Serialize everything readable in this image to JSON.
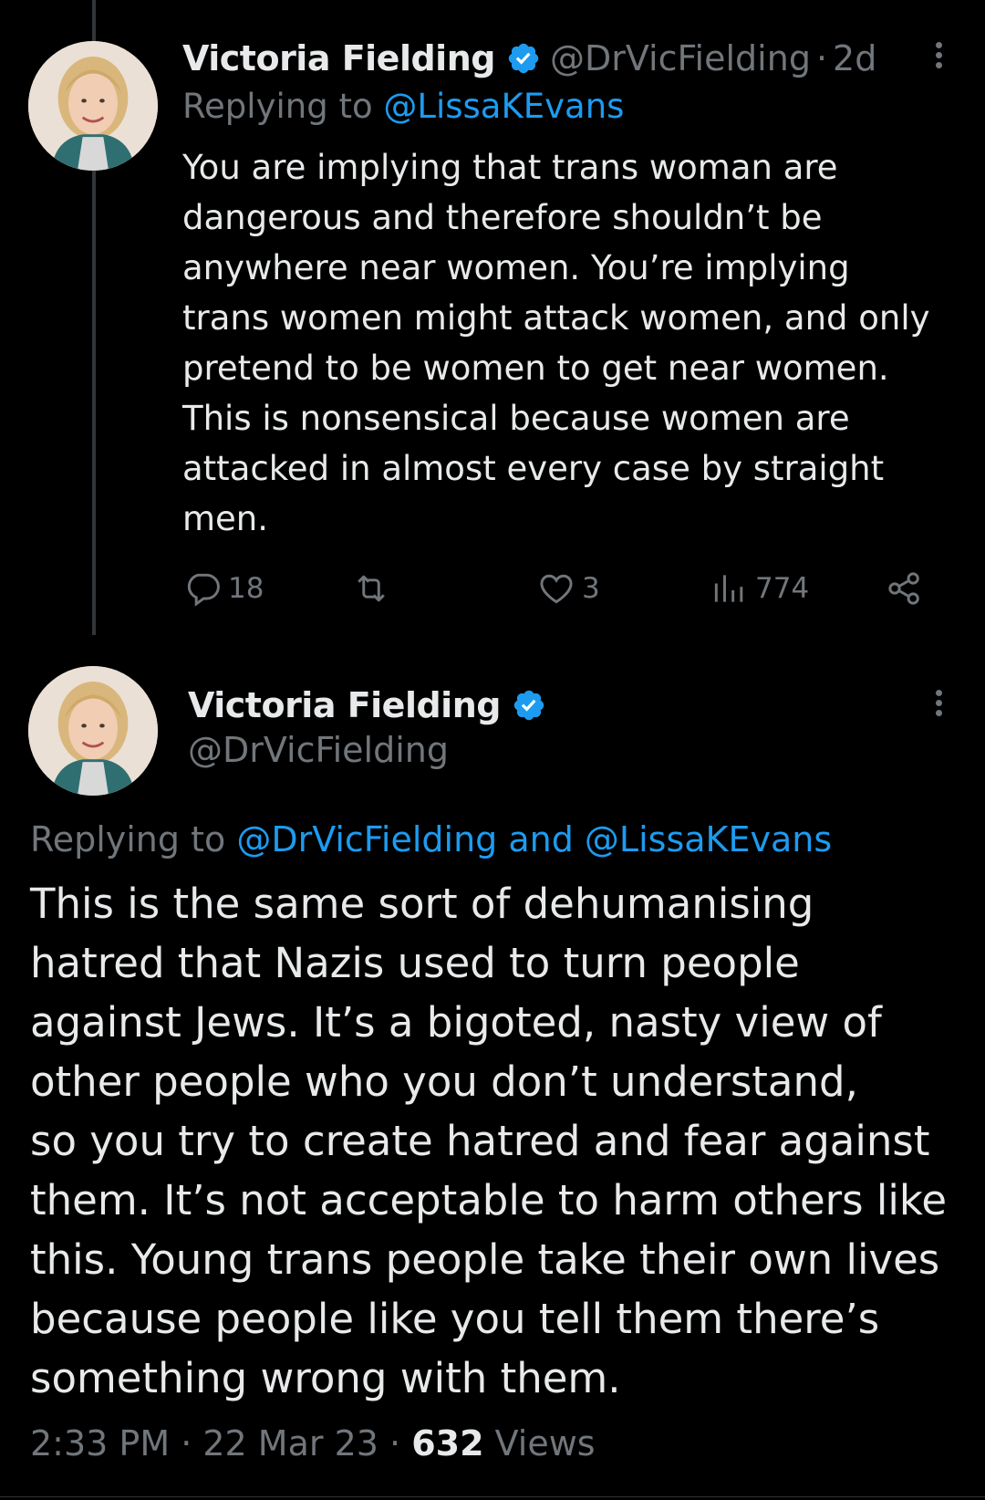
{
  "colors": {
    "background": "#000000",
    "text": "#e7e9ea",
    "muted": "#71767b",
    "link": "#1d9bf0",
    "verified_badge": "#1d9bf0"
  },
  "reply_tweet": {
    "avatar_icon": "profile-photo",
    "author_name": "Victoria Fielding",
    "handle": "@DrVicFielding",
    "separator": "·",
    "time_ago": "2d",
    "replying_prefix": "Replying to ",
    "replying_to": "@LissaKEvans",
    "body": "You are implying that trans woman are\ndangerous and therefore shouldn’t be\nanywhere near women. You’re implying\ntrans women might attack women, and only\npretend to be women to get near women.\nThis is nonsensical because women are\nattacked in almost every case by straight\nmen.",
    "actions": {
      "replies": "18",
      "retweets": "",
      "likes": "3",
      "views": "774"
    }
  },
  "main_tweet": {
    "avatar_icon": "profile-photo",
    "author_name": "Victoria Fielding",
    "handle": "@DrVicFielding",
    "replying_prefix": "Replying to ",
    "replying_to": "@DrVicFielding and @LissaKEvans",
    "body": "This is the same sort of dehumanising\nhatred that Nazis used to turn people\nagainst Jews. It’s a bigoted, nasty view of\nother people who you don’t understand,\nso you try to create hatred and fear against\nthem. It’s not acceptable to harm others like\nthis. Young trans people take their own lives\nbecause people like you tell them there’s\nsomething wrong with them.",
    "time": "2:33 PM",
    "separator": " · ",
    "date": "22 Mar 23",
    "view_count": "632",
    "views_label": " Views"
  }
}
